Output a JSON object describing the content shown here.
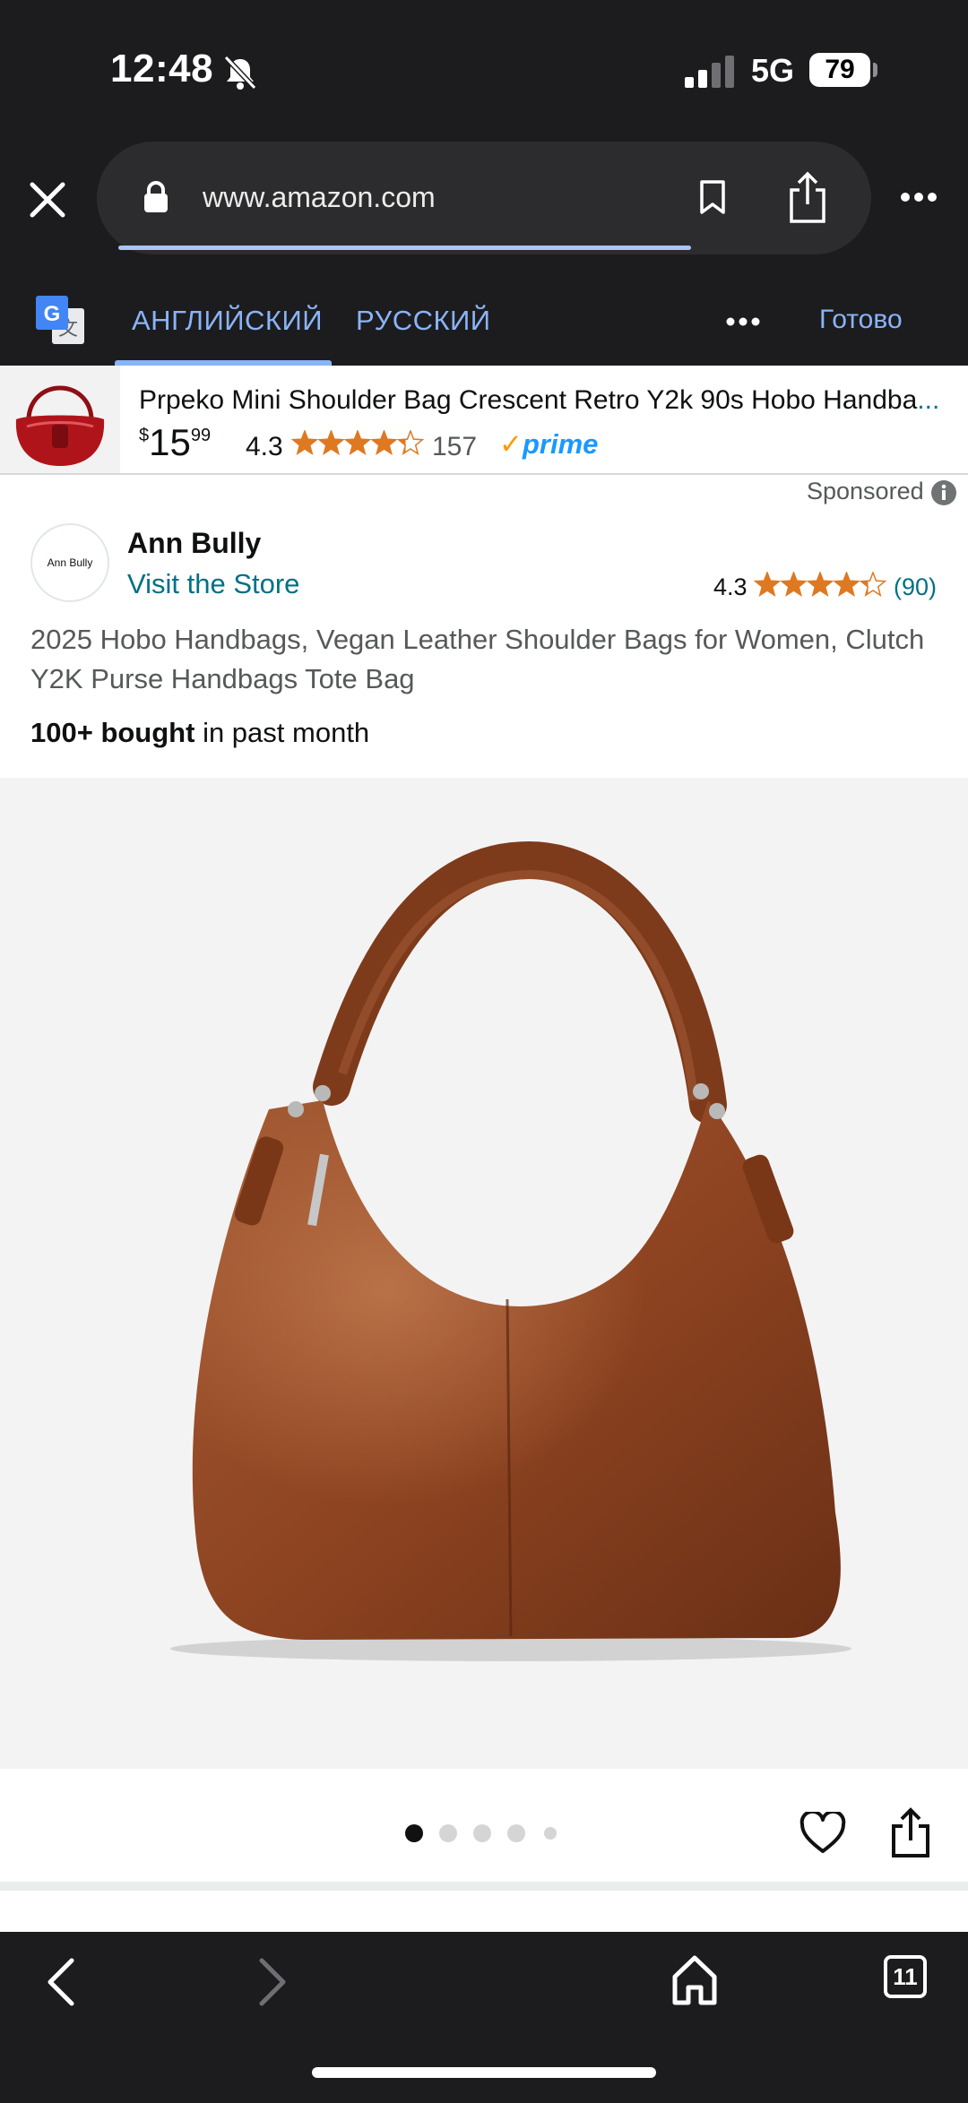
{
  "status_bar": {
    "time": "12:48",
    "network": "5G",
    "battery": "79"
  },
  "browser": {
    "url": "www.amazon.com",
    "load_progress": 0.85,
    "open_tabs": "11"
  },
  "translate_bar": {
    "source_lang": "АНГЛИЙСКИЙ",
    "target_lang": "РУССКИЙ",
    "done_label": "Готово",
    "active_tab": "source"
  },
  "sticky_product": {
    "title": "Prpeko Mini Shoulder Bag Crescent Retro Y2k 90s Hobo Handba",
    "ellipsis": "...",
    "price_symbol": "$",
    "price_whole": "15",
    "price_fraction": "99",
    "rating": "4.3",
    "rating_value": 4.3,
    "review_count": "157",
    "prime_check": "✓",
    "prime_label": "prime"
  },
  "listing": {
    "sponsored_label": "Sponsored",
    "brand_logo_text": "Ann Bully",
    "brand_name": "Ann Bully",
    "visit_store": "Visit the Store",
    "rating": "4.3",
    "rating_value": 4.3,
    "review_count": "(90)",
    "title": "2025 Hobo Handbags, Vegan Leather Shoulder Bags for Women, Clutch Y2K Purse Handbags Tote Bag",
    "bought_bold": "100+ bought",
    "bought_rest": " in past month"
  },
  "gallery": {
    "image_count": 5,
    "active_index": 0
  },
  "colors": {
    "chrome_bg": "#1c1c1e",
    "link": "#007185",
    "star": "#de7921",
    "google_blue": "#8ab4f8",
    "prime_blue": "#1a98ff",
    "bag_brown": "#8a4322"
  }
}
